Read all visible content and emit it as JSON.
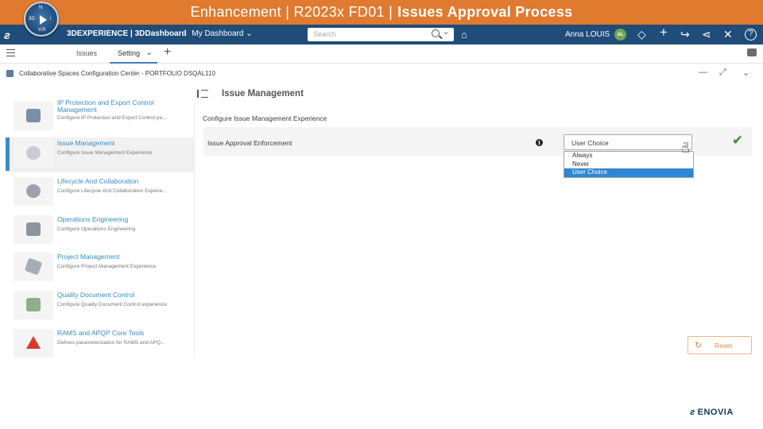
{
  "banner": {
    "title_part1": "Enhancement | R2023x FD01 |",
    "title_part2": "Issues Approval Process"
  },
  "topbar": {
    "brand_bold": "3DEXPERIENCE | 3DDashboard",
    "dashboard": "My Dashboard",
    "search_placeholder": "Search",
    "user_name": "Anna LOUIS",
    "user_initials": "AL"
  },
  "tabs": {
    "items": [
      {
        "label": "Issues"
      },
      {
        "label": "Setting"
      }
    ],
    "active": "Setting"
  },
  "window": {
    "title": "Collaborative Spaces Configuration Center - PORTFOLIO DSQAL110"
  },
  "sidebar": {
    "items": [
      {
        "title": "IP Protection and Export Control Management",
        "title_line1": "IP Protection and Export Control",
        "title_line2": "Management",
        "desc": "Configure IP Protection and Export Control pa..."
      },
      {
        "title": "Issue Management",
        "desc": "Configure Issue Management Experience",
        "selected": true
      },
      {
        "title": "Lifecycle And Collaboration",
        "desc": "Configure Lifecycle And Collaboration Experie..."
      },
      {
        "title": "Operations Engineering",
        "desc": "Configure Operations Engineering"
      },
      {
        "title": "Project Management",
        "desc": "Configure Project Management Experience"
      },
      {
        "title": "Quality Document Control",
        "desc": "Configure Quality Document Control experience"
      },
      {
        "title": "RAMS and APQP Core Tools",
        "desc": "Defines parameterization for RAMS and APQ..."
      }
    ]
  },
  "main": {
    "title": "Issue Management",
    "section": "Configure Issue Management Experience",
    "setting": {
      "label": "Issue Approval Enforcement",
      "value": "User Choice",
      "options": [
        "Always",
        "Never",
        "User Choice"
      ],
      "selected_option": "User Choice"
    },
    "reset_label": "Reset"
  },
  "footer": {
    "logo_text": "ENOVIA"
  },
  "icons": {
    "accent": "#368ec4",
    "topbar_bg": "#1f4c79",
    "banner_bg": "#e07a2e"
  }
}
